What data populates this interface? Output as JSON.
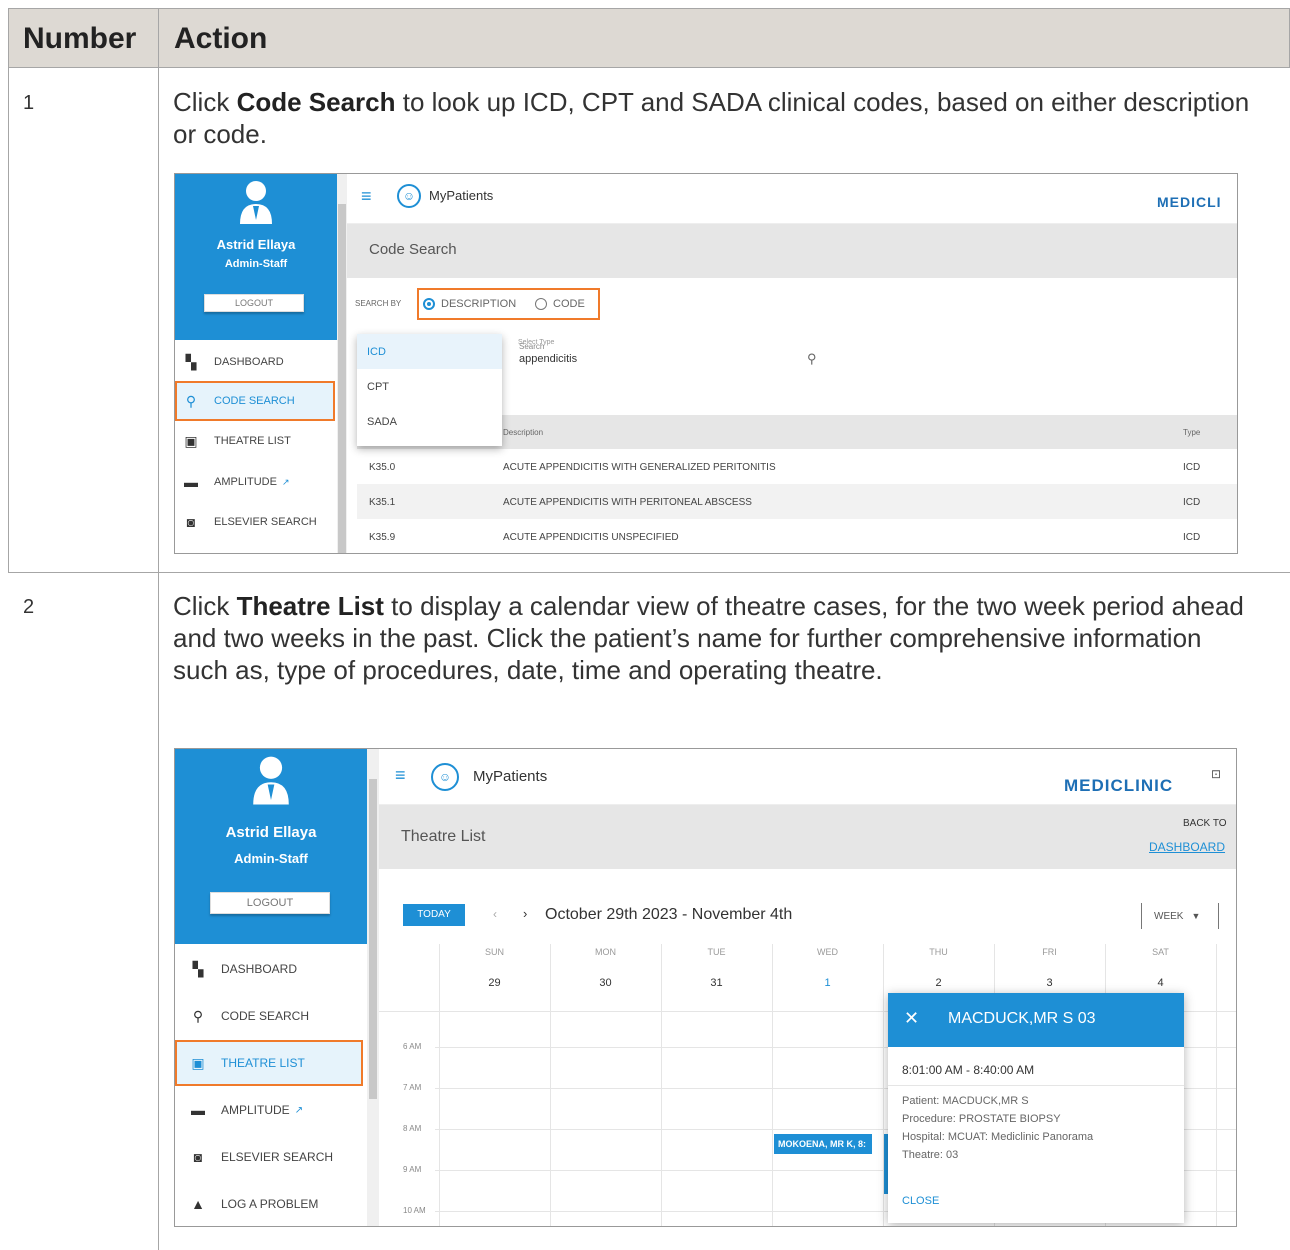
{
  "table": {
    "col_number": "Number",
    "col_action": "Action"
  },
  "rows": [
    {
      "number": "1",
      "text_pre": "Click ",
      "text_bold": "Code Search",
      "text_post": " to look up ICD, CPT and SADA clinical codes, based on either description or code."
    },
    {
      "number": "2",
      "text_pre": "Click ",
      "text_bold": "Theatre List",
      "text_post": " to display a calendar view of theatre cases, for the two week period ahead and two weeks in the past. Click the patient’s name for further comprehensive information such as, type of procedures, date, time and operating theatre."
    }
  ],
  "app": {
    "user_name": "Astrid Ellaya",
    "user_role": "Admin-Staff",
    "logout": "LOGOUT",
    "app_name": "MyPatients",
    "brand_cut": "MEDICLI",
    "brand": "MEDICLINIC",
    "nav1": [
      {
        "label": "DASHBOARD",
        "icon": "dashboard-icon"
      },
      {
        "label": "CODE SEARCH",
        "icon": "search-icon"
      },
      {
        "label": "THEATRE LIST",
        "icon": "calendar-icon"
      },
      {
        "label": "AMPLITUDE",
        "icon": "briefcase-icon"
      },
      {
        "label": "ELSEVIER SEARCH",
        "icon": "elsevier-icon"
      }
    ],
    "nav2_extra": {
      "label": "LOG A PROBLEM",
      "icon": "warning-icon"
    }
  },
  "code_search": {
    "title": "Code Search",
    "search_by": "SEARCH BY",
    "opt_description": "DESCRIPTION",
    "opt_code": "CODE",
    "select_type": "Select Type",
    "search_label": "Search",
    "search_value": "appendicitis",
    "dropdown": [
      "ICD",
      "CPT",
      "SADA"
    ],
    "col_description": "Description",
    "col_type": "Type",
    "results": [
      {
        "code": "K35.0",
        "description": "ACUTE APPENDICITIS WITH GENERALIZED PERITONITIS",
        "type": "ICD"
      },
      {
        "code": "K35.1",
        "description": "ACUTE APPENDICITIS WITH PERITONEAL ABSCESS",
        "type": "ICD"
      },
      {
        "code": "K35.9",
        "description": "ACUTE APPENDICITIS UNSPECIFIED",
        "type": "ICD"
      }
    ]
  },
  "theatre_list": {
    "title": "Theatre List",
    "back_to": "BACK TO",
    "dashboard_link": "DASHBOARD",
    "today": "TODAY",
    "range": "October 29th 2023 - November 4th",
    "view": "WEEK",
    "days": [
      {
        "dow": "SUN",
        "date": "29"
      },
      {
        "dow": "MON",
        "date": "30"
      },
      {
        "dow": "TUE",
        "date": "31"
      },
      {
        "dow": "WED",
        "date": "1"
      },
      {
        "dow": "THU",
        "date": "2"
      },
      {
        "dow": "FRI",
        "date": "3"
      },
      {
        "dow": "SAT",
        "date": "4"
      }
    ],
    "hours": [
      "6 AM",
      "7 AM",
      "8 AM",
      "9 AM",
      "10 AM"
    ],
    "event": "MOKOENA, MR K, 8:",
    "popup": {
      "title": "MACDUCK,MR S 03",
      "time": "8:01:00 AM - 8:40:00 AM",
      "patient": "Patient: MACDUCK,MR S",
      "procedure": "Procedure: PROSTATE BIOPSY",
      "hospital": "Hospital: MCUAT: Mediclinic Panorama",
      "theatre": "Theatre: 03",
      "close": "CLOSE"
    }
  }
}
